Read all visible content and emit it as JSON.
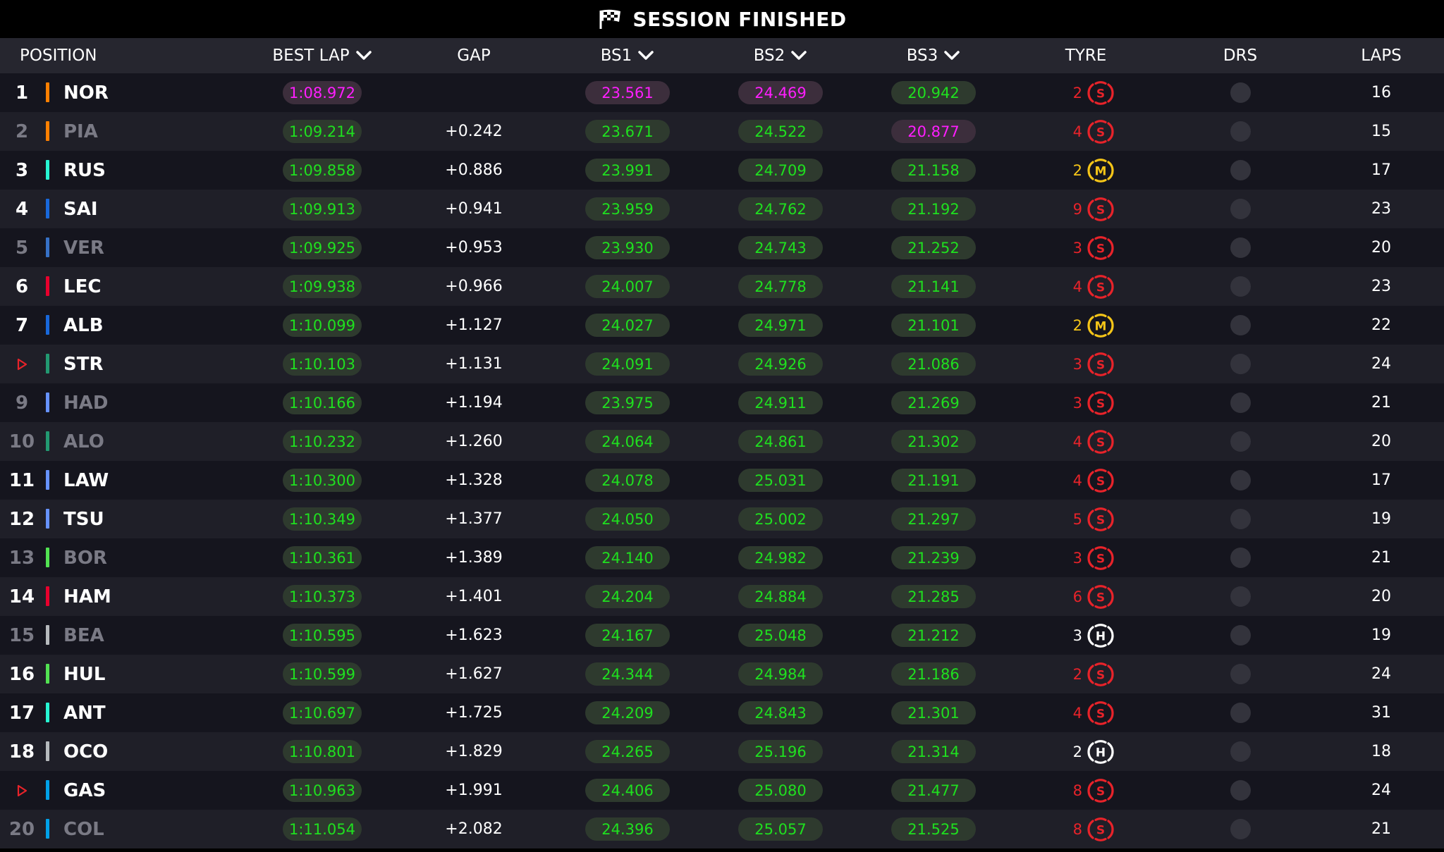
{
  "header": {
    "title": "SESSION FINISHED"
  },
  "columns": {
    "position": "POSITION",
    "best_lap": "BEST LAP",
    "gap": "GAP",
    "bs1": "BS1",
    "bs2": "BS2",
    "bs3": "BS3",
    "tyre": "TYRE",
    "drs": "DRS",
    "laps": "LAPS"
  },
  "colors": {
    "fastest_purple": "#ff1eff",
    "personal_green": "#1fe01f",
    "soft_red": "#e8232a",
    "medium_yellow": "#f5c518",
    "hard_white": "#ffffff"
  },
  "rows": [
    {
      "pos": "1",
      "code": "NOR",
      "team_color": "#ff8000",
      "dim": false,
      "best_lap": "1:08.972",
      "best_lap_purple": true,
      "gap": "",
      "bs1": "23.561",
      "bs1_purple": true,
      "bs2": "24.469",
      "bs2_purple": true,
      "bs3": "20.942",
      "bs3_purple": false,
      "tyre_laps": "2",
      "compound": "S",
      "laps": "16"
    },
    {
      "pos": "2",
      "code": "PIA",
      "team_color": "#ff8000",
      "dim": true,
      "best_lap": "1:09.214",
      "best_lap_purple": false,
      "gap": "+0.242",
      "bs1": "23.671",
      "bs1_purple": false,
      "bs2": "24.522",
      "bs2_purple": false,
      "bs3": "20.877",
      "bs3_purple": true,
      "tyre_laps": "4",
      "compound": "S",
      "laps": "15"
    },
    {
      "pos": "3",
      "code": "RUS",
      "team_color": "#27f4d2",
      "dim": false,
      "best_lap": "1:09.858",
      "best_lap_purple": false,
      "gap": "+0.886",
      "bs1": "23.991",
      "bs1_purple": false,
      "bs2": "24.709",
      "bs2_purple": false,
      "bs3": "21.158",
      "bs3_purple": false,
      "tyre_laps": "2",
      "compound": "M",
      "laps": "17"
    },
    {
      "pos": "4",
      "code": "SAI",
      "team_color": "#1868db",
      "dim": false,
      "best_lap": "1:09.913",
      "best_lap_purple": false,
      "gap": "+0.941",
      "bs1": "23.959",
      "bs1_purple": false,
      "bs2": "24.762",
      "bs2_purple": false,
      "bs3": "21.192",
      "bs3_purple": false,
      "tyre_laps": "9",
      "compound": "S",
      "laps": "23"
    },
    {
      "pos": "5",
      "code": "VER",
      "team_color": "#3671c6",
      "dim": true,
      "best_lap": "1:09.925",
      "best_lap_purple": false,
      "gap": "+0.953",
      "bs1": "23.930",
      "bs1_purple": false,
      "bs2": "24.743",
      "bs2_purple": false,
      "bs3": "21.252",
      "bs3_purple": false,
      "tyre_laps": "3",
      "compound": "S",
      "laps": "20"
    },
    {
      "pos": "6",
      "code": "LEC",
      "team_color": "#e8002d",
      "dim": false,
      "best_lap": "1:09.938",
      "best_lap_purple": false,
      "gap": "+0.966",
      "bs1": "24.007",
      "bs1_purple": false,
      "bs2": "24.778",
      "bs2_purple": false,
      "bs3": "21.141",
      "bs3_purple": false,
      "tyre_laps": "4",
      "compound": "S",
      "laps": "23"
    },
    {
      "pos": "7",
      "code": "ALB",
      "team_color": "#1868db",
      "dim": false,
      "best_lap": "1:10.099",
      "best_lap_purple": false,
      "gap": "+1.127",
      "bs1": "24.027",
      "bs1_purple": false,
      "bs2": "24.971",
      "bs2_purple": false,
      "bs3": "21.101",
      "bs3_purple": false,
      "tyre_laps": "2",
      "compound": "M",
      "laps": "22"
    },
    {
      "pos": "",
      "pos_arrow": true,
      "code": "STR",
      "team_color": "#229971",
      "dim": false,
      "best_lap": "1:10.103",
      "best_lap_purple": false,
      "gap": "+1.131",
      "bs1": "24.091",
      "bs1_purple": false,
      "bs2": "24.926",
      "bs2_purple": false,
      "bs3": "21.086",
      "bs3_purple": false,
      "tyre_laps": "3",
      "compound": "S",
      "laps": "24"
    },
    {
      "pos": "9",
      "code": "HAD",
      "team_color": "#6692ff",
      "dim": true,
      "best_lap": "1:10.166",
      "best_lap_purple": false,
      "gap": "+1.194",
      "bs1": "23.975",
      "bs1_purple": false,
      "bs2": "24.911",
      "bs2_purple": false,
      "bs3": "21.269",
      "bs3_purple": false,
      "tyre_laps": "3",
      "compound": "S",
      "laps": "21"
    },
    {
      "pos": "10",
      "code": "ALO",
      "team_color": "#229971",
      "dim": true,
      "best_lap": "1:10.232",
      "best_lap_purple": false,
      "gap": "+1.260",
      "bs1": "24.064",
      "bs1_purple": false,
      "bs2": "24.861",
      "bs2_purple": false,
      "bs3": "21.302",
      "bs3_purple": false,
      "tyre_laps": "4",
      "compound": "S",
      "laps": "20"
    },
    {
      "pos": "11",
      "code": "LAW",
      "team_color": "#6692ff",
      "dim": false,
      "best_lap": "1:10.300",
      "best_lap_purple": false,
      "gap": "+1.328",
      "bs1": "24.078",
      "bs1_purple": false,
      "bs2": "25.031",
      "bs2_purple": false,
      "bs3": "21.191",
      "bs3_purple": false,
      "tyre_laps": "4",
      "compound": "S",
      "laps": "17"
    },
    {
      "pos": "12",
      "code": "TSU",
      "team_color": "#6692ff",
      "dim": false,
      "best_lap": "1:10.349",
      "best_lap_purple": false,
      "gap": "+1.377",
      "bs1": "24.050",
      "bs1_purple": false,
      "bs2": "25.002",
      "bs2_purple": false,
      "bs3": "21.297",
      "bs3_purple": false,
      "tyre_laps": "5",
      "compound": "S",
      "laps": "19"
    },
    {
      "pos": "13",
      "code": "BOR",
      "team_color": "#52e252",
      "dim": true,
      "best_lap": "1:10.361",
      "best_lap_purple": false,
      "gap": "+1.389",
      "bs1": "24.140",
      "bs1_purple": false,
      "bs2": "24.982",
      "bs2_purple": false,
      "bs3": "21.239",
      "bs3_purple": false,
      "tyre_laps": "3",
      "compound": "S",
      "laps": "21"
    },
    {
      "pos": "14",
      "code": "HAM",
      "team_color": "#e8002d",
      "dim": false,
      "best_lap": "1:10.373",
      "best_lap_purple": false,
      "gap": "+1.401",
      "bs1": "24.204",
      "bs1_purple": false,
      "bs2": "24.884",
      "bs2_purple": false,
      "bs3": "21.285",
      "bs3_purple": false,
      "tyre_laps": "6",
      "compound": "S",
      "laps": "20"
    },
    {
      "pos": "15",
      "code": "BEA",
      "team_color": "#b6babd",
      "dim": true,
      "best_lap": "1:10.595",
      "best_lap_purple": false,
      "gap": "+1.623",
      "bs1": "24.167",
      "bs1_purple": false,
      "bs2": "25.048",
      "bs2_purple": false,
      "bs3": "21.212",
      "bs3_purple": false,
      "tyre_laps": "3",
      "compound": "H",
      "laps": "19"
    },
    {
      "pos": "16",
      "code": "HUL",
      "team_color": "#52e252",
      "dim": false,
      "best_lap": "1:10.599",
      "best_lap_purple": false,
      "gap": "+1.627",
      "bs1": "24.344",
      "bs1_purple": false,
      "bs2": "24.984",
      "bs2_purple": false,
      "bs3": "21.186",
      "bs3_purple": false,
      "tyre_laps": "2",
      "compound": "S",
      "laps": "24"
    },
    {
      "pos": "17",
      "code": "ANT",
      "team_color": "#27f4d2",
      "dim": false,
      "best_lap": "1:10.697",
      "best_lap_purple": false,
      "gap": "+1.725",
      "bs1": "24.209",
      "bs1_purple": false,
      "bs2": "24.843",
      "bs2_purple": false,
      "bs3": "21.301",
      "bs3_purple": false,
      "tyre_laps": "4",
      "compound": "S",
      "laps": "31"
    },
    {
      "pos": "18",
      "code": "OCO",
      "team_color": "#b6babd",
      "dim": false,
      "best_lap": "1:10.801",
      "best_lap_purple": false,
      "gap": "+1.829",
      "bs1": "24.265",
      "bs1_purple": false,
      "bs2": "25.196",
      "bs2_purple": false,
      "bs3": "21.314",
      "bs3_purple": false,
      "tyre_laps": "2",
      "compound": "H",
      "laps": "18"
    },
    {
      "pos": "",
      "pos_arrow": true,
      "code": "GAS",
      "team_color": "#00a1e8",
      "dim": false,
      "best_lap": "1:10.963",
      "best_lap_purple": false,
      "gap": "+1.991",
      "bs1": "24.406",
      "bs1_purple": false,
      "bs2": "25.080",
      "bs2_purple": false,
      "bs3": "21.477",
      "bs3_purple": false,
      "tyre_laps": "8",
      "compound": "S",
      "laps": "24"
    },
    {
      "pos": "20",
      "code": "COL",
      "team_color": "#00a1e8",
      "dim": true,
      "best_lap": "1:11.054",
      "best_lap_purple": false,
      "gap": "+2.082",
      "bs1": "24.396",
      "bs1_purple": false,
      "bs2": "25.057",
      "bs2_purple": false,
      "bs3": "21.525",
      "bs3_purple": false,
      "tyre_laps": "8",
      "compound": "S",
      "laps": "21"
    }
  ]
}
